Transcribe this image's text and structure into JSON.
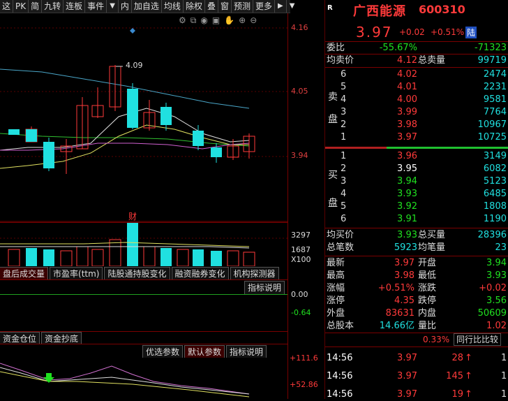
{
  "toolbar": {
    "items": [
      "这",
      "PK",
      "简",
      "九转",
      "连板",
      "事件",
      "▼",
      "内",
      "加自选",
      "均线",
      "除权",
      "叠",
      "窗",
      "预测",
      "更多"
    ],
    "more_arrow": "▶",
    "nav_arrow": "▼"
  },
  "chart": {
    "price_labels": [
      "4.16",
      "4.05",
      "3.94"
    ],
    "high_label": "4.09",
    "cai_label": "财",
    "vol_labels": [
      "3297",
      "1687",
      "X100"
    ],
    "icons": [
      "gear-icon",
      "copy-icon",
      "eye-icon",
      "briefcase-icon",
      "hand-icon",
      "plus-icon",
      "minus-icon"
    ]
  },
  "tabs1": [
    "盘后成交量",
    "市盈率(ttm)",
    "陆股通持股变化",
    "融资融券变化",
    "机构探测器"
  ],
  "indicator1": {
    "button": "指标说明",
    "values": [
      "0.00",
      "-0.64"
    ]
  },
  "tabs2": [
    "资金仓位",
    "资金抄底"
  ],
  "indicator2": {
    "buttons": [
      "优选参数",
      "默认参数",
      "指标说明"
    ],
    "values": [
      "+111.6",
      "+52.86"
    ]
  },
  "stock": {
    "marker": "R",
    "name": "广西能源",
    "code": "600310",
    "price": "3.97",
    "change": "+0.02",
    "pct": "+0.51%",
    "tag": "陆"
  },
  "weibi": {
    "label": "委比",
    "pct": "-55.67%",
    "diff": "-71323"
  },
  "junmai": {
    "label": "均卖价",
    "value": "4.12",
    "label2": "总卖量",
    "value2": "99719"
  },
  "sell_side_label": [
    "卖",
    "盘"
  ],
  "buy_side_label": [
    "买",
    "盘"
  ],
  "sells": [
    {
      "n": "6",
      "price": "4.02",
      "vol": "2474"
    },
    {
      "n": "5",
      "price": "4.01",
      "vol": "2231"
    },
    {
      "n": "4",
      "price": "4.00",
      "vol": "9581"
    },
    {
      "n": "3",
      "price": "3.99",
      "vol": "7764"
    },
    {
      "n": "2",
      "price": "3.98",
      "vol": "10967"
    },
    {
      "n": "1",
      "price": "3.97",
      "vol": "10725"
    }
  ],
  "buys": [
    {
      "n": "1",
      "price": "3.96",
      "vol": "3149"
    },
    {
      "n": "2",
      "price": "3.95",
      "vol": "6082"
    },
    {
      "n": "3",
      "price": "3.94",
      "vol": "5123"
    },
    {
      "n": "4",
      "price": "3.93",
      "vol": "6485"
    },
    {
      "n": "5",
      "price": "3.92",
      "vol": "1808"
    },
    {
      "n": "6",
      "price": "3.91",
      "vol": "1190"
    }
  ],
  "junmai_buy": {
    "label": "均买价",
    "value": "3.93",
    "label2": "总买量",
    "value2": "28396"
  },
  "bishu": {
    "label": "总笔数",
    "value": "5923",
    "label2": "均笔量",
    "value2": "23"
  },
  "stats": [
    {
      "l1": "最新",
      "v1": "3.97",
      "l2": "开盘",
      "v2": "3.94"
    },
    {
      "l1": "最高",
      "v1": "3.98",
      "l2": "最低",
      "v2": "3.93"
    },
    {
      "l1": "涨幅",
      "v1": "+0.51%",
      "l2": "涨跌",
      "v2": "+0.02"
    },
    {
      "l1": "涨停",
      "v1": "4.35",
      "l2": "跌停",
      "v2": "3.56"
    },
    {
      "l1": "外盘",
      "v1": "83631",
      "l2": "内盘",
      "v2": "50609"
    },
    {
      "l1": "总股本",
      "v1": "14.66亿",
      "l2": "量比",
      "v2": "1.02"
    }
  ],
  "compare": {
    "pct": "0.33%",
    "button": "同行比比较"
  },
  "ticks": [
    {
      "time": "14:56",
      "price": "3.97",
      "vol": "28",
      "dir": "↑",
      "flag": "1"
    },
    {
      "time": "14:56",
      "price": "3.97",
      "vol": "145",
      "dir": "↑",
      "flag": "1"
    },
    {
      "time": "14:56",
      "price": "3.97",
      "vol": "19",
      "dir": "↑",
      "flag": "1"
    }
  ],
  "colors": {
    "up": "#ff3a3a",
    "down": "#20e0e0",
    "grid": "#7a0000",
    "bg": "#000000"
  }
}
